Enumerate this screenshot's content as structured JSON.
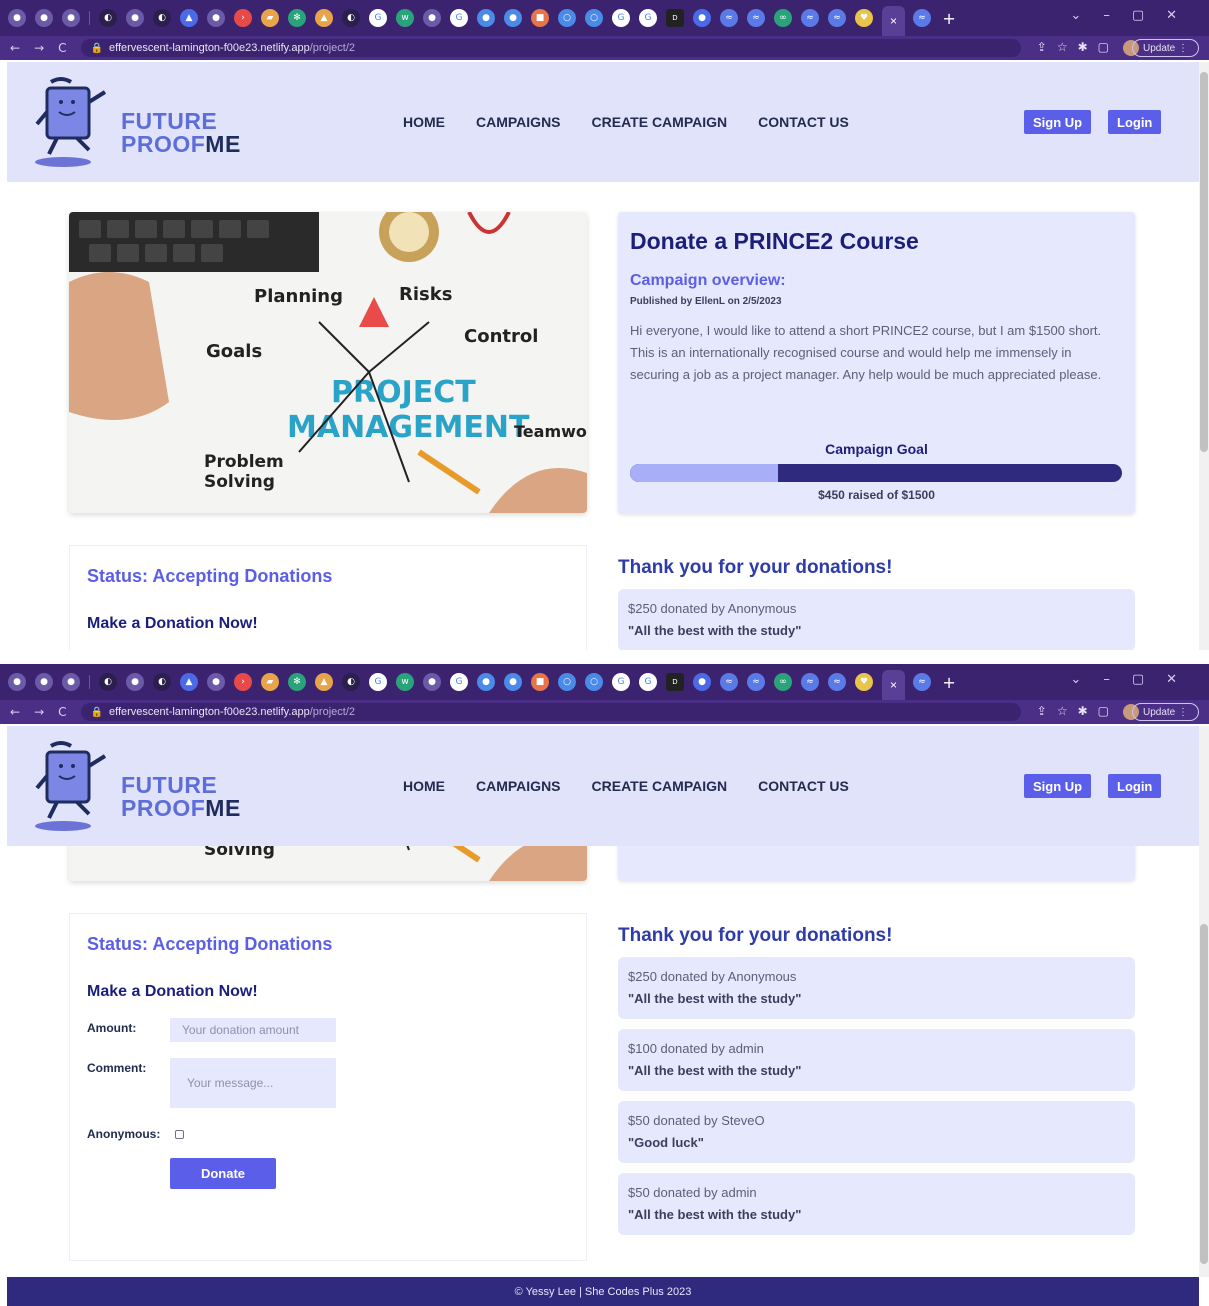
{
  "browser": {
    "active_tab_close": "×",
    "new_tab": "+",
    "url_host": "effervescent-lamington-f00e23.netlify.app",
    "url_path": "/project/2",
    "update_label": "Update"
  },
  "site": {
    "logo_line1": "FUTURE",
    "logo_line2_a": "PROOF",
    "logo_line2_b": "ME",
    "nav": [
      "HOME",
      "CAMPAIGNS",
      "CREATE CAMPAIGN",
      "CONTACT US"
    ],
    "signup": "Sign Up",
    "login": "Login"
  },
  "campaign": {
    "title": "Donate a PRINCE2 Course",
    "overview_heading": "Campaign overview:",
    "published": "Published by EllenL on 2/5/2023",
    "description": "Hi everyone, I would like to attend a short PRINCE2 course, but I am $1500 short. This is an internationally recognised course and would help me immensely in securing a job as a project manager. Any help would be much appreciated please.",
    "goal_label": "Campaign Goal",
    "raised_text": "$450 raised of $1500",
    "progress_fraction": 0.3
  },
  "hero_image": {
    "words": [
      "Planning",
      "Risks",
      "Goals",
      "Control",
      "PROJECT",
      "MANAGEMENT",
      "Teamwo",
      "Problem",
      "Solving"
    ]
  },
  "donate_form": {
    "status": "Status: Accepting Donations",
    "heading": "Make a Donation Now!",
    "amount_label": "Amount:",
    "amount_placeholder": "Your donation amount",
    "comment_label": "Comment:",
    "comment_placeholder": "Your message...",
    "anonymous_label": "Anonymous:",
    "button": "Donate"
  },
  "donations": {
    "heading": "Thank you for your donations!",
    "items": [
      {
        "line": "$250 donated by Anonymous",
        "comment": "\"All the best with the study\""
      },
      {
        "line": "$100 donated by admin",
        "comment": "\"All the best with the study\""
      },
      {
        "line": "$50 donated by SteveO",
        "comment": "\"Good luck\""
      },
      {
        "line": "$50 donated by admin",
        "comment": "\"All the best with the study\""
      }
    ]
  },
  "footer": "© Yessy Lee | She Codes Plus 2023",
  "colors": {
    "accent": "#5b5ee8",
    "header_bg": "#e1e3fb",
    "card_bg": "#e6e8fd",
    "progress_track": "#2f2a7e",
    "progress_fill": "#a8aef8",
    "chrome": "#3b2370"
  }
}
